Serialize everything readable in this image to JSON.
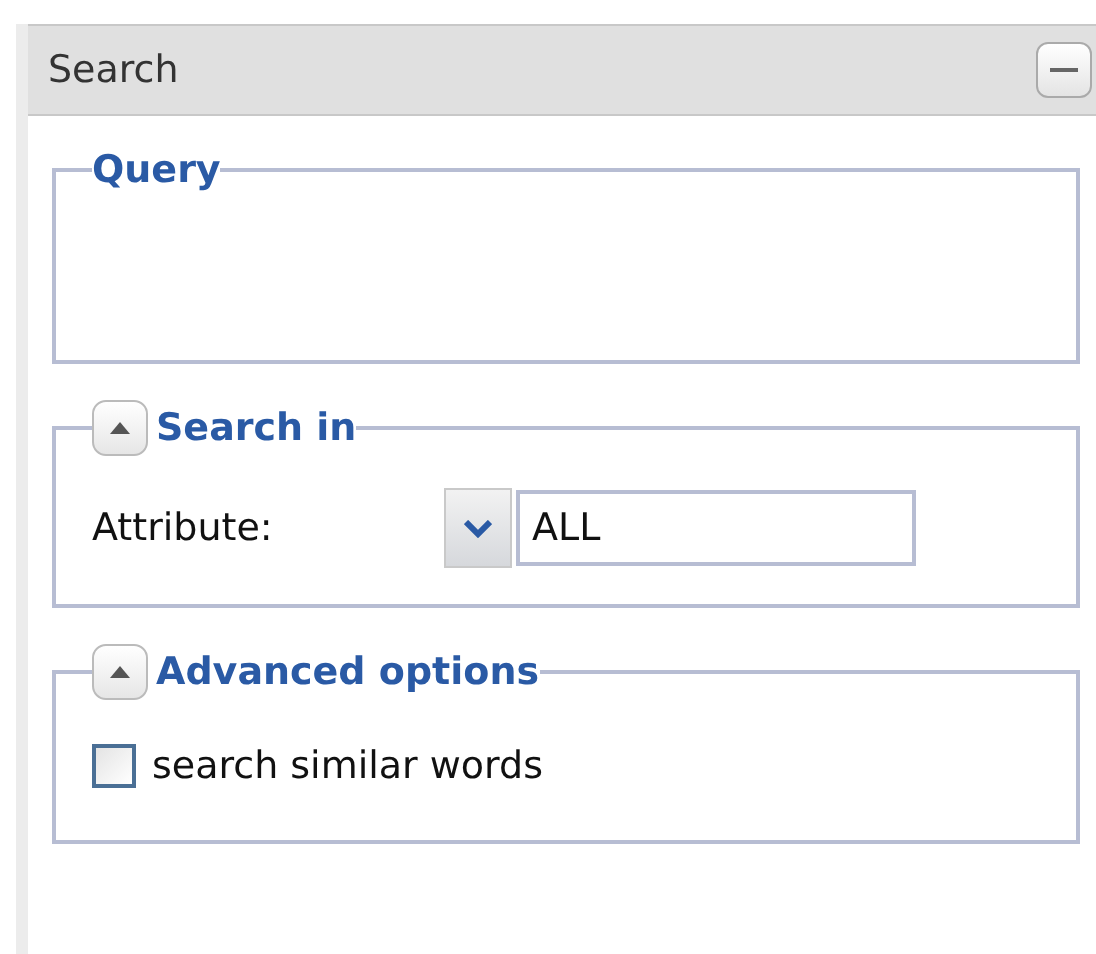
{
  "panel": {
    "title": "Search"
  },
  "sections": [
    {
      "kind": "query",
      "legend": "Query"
    },
    {
      "kind": "search_in",
      "legend": "Search in",
      "expanded": true,
      "attribute_label": "Attribute:",
      "attribute_value": "ALL"
    },
    {
      "kind": "advanced",
      "legend": "Advanced options",
      "expanded": true,
      "option": {
        "label": "search similar words",
        "checked": false
      }
    }
  ]
}
